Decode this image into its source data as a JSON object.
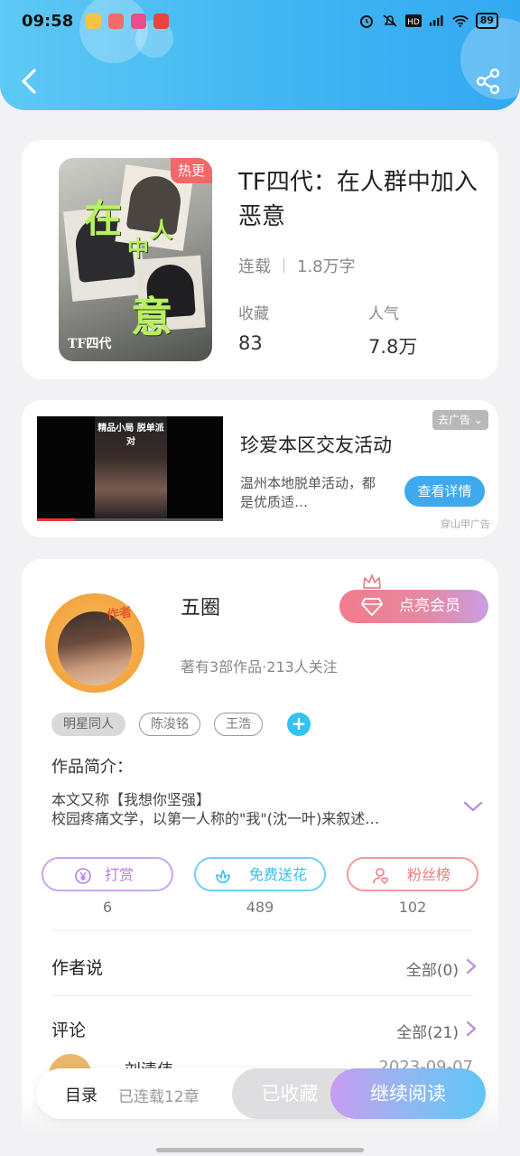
{
  "status_bar": {
    "time": "09:58",
    "battery": "89"
  },
  "book": {
    "hot_badge": "热更",
    "cover_caption": "TF四代",
    "cover_big_chars": [
      "在",
      "人",
      "中",
      "意"
    ],
    "title": "TF四代：在人群中加入恶意",
    "status": "连载",
    "word_count": "1.8万字",
    "favorites_label": "收藏",
    "favorites_value": "83",
    "popularity_label": "人气",
    "popularity_value": "7.8万"
  },
  "ad": {
    "video_caption": "精品小局 脱单派对",
    "title": "珍爱本区交友活动",
    "description": "温州本地脱单活动，都是优质适…",
    "button": "查看详情",
    "close": "去广告",
    "source": "穿山甲广告"
  },
  "author": {
    "badge": "作者",
    "name": "五圈",
    "meta": "著有3部作品·213人关注",
    "vip_button": "点亮会员",
    "tags": [
      "明星同人",
      "陈浚铭",
      "王浩"
    ],
    "add_tag": "+",
    "intro_label": "作品简介：",
    "intro_lines": [
      "本文又称【我想你坚强】",
      "校园疼痛文学，以第一人称的\"我\"(沈一叶)来叙述…"
    ]
  },
  "actions": [
    {
      "label": "打赏",
      "count": "6",
      "color": "#b47fe8"
    },
    {
      "label": "免费送花",
      "count": "489",
      "color": "#37c0ea"
    },
    {
      "label": "粉丝榜",
      "count": "102",
      "color": "#f07a7a"
    }
  ],
  "author_says": {
    "label": "作者说",
    "right": "全部(0)"
  },
  "comments": {
    "label": "评论",
    "right": "全部(21)",
    "peek_name": "刘清伟",
    "peek_date": "2023-09-07"
  },
  "bottom_bar": {
    "toc": "目录",
    "toc_sub": "已连载12章",
    "collected": "已收藏",
    "continue": "继续阅读"
  }
}
